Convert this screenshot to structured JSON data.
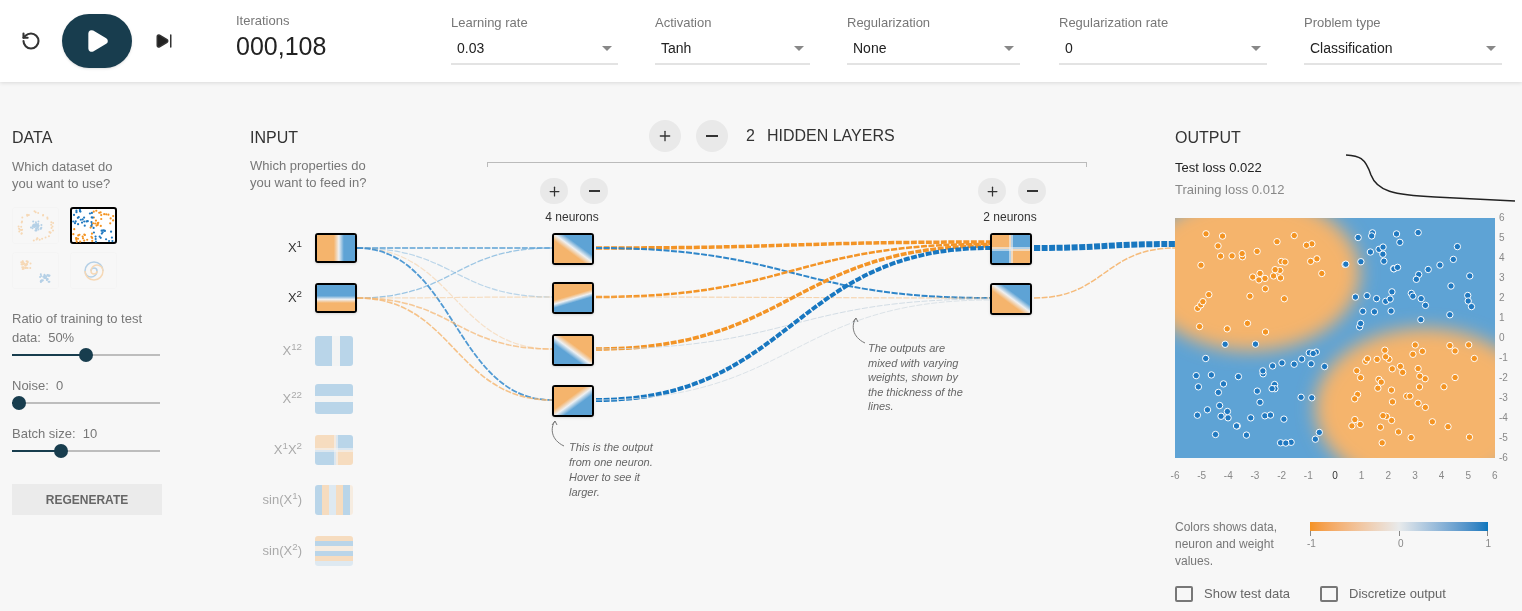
{
  "toolbar": {
    "iterations": {
      "label": "Iterations",
      "value": "000,108"
    },
    "dropdowns": [
      {
        "label": "Learning rate",
        "value": "0.03"
      },
      {
        "label": "Activation",
        "value": "Tanh"
      },
      {
        "label": "Regularization",
        "value": "None"
      },
      {
        "label": "Regularization rate",
        "value": "0"
      },
      {
        "label": "Problem type",
        "value": "Classification"
      }
    ]
  },
  "data": {
    "title": "DATA",
    "question": "Which dataset do you want to use?",
    "datasets": [
      {
        "kind": "circle",
        "selected": false
      },
      {
        "kind": "xor",
        "selected": true
      },
      {
        "kind": "gaussian",
        "selected": false
      },
      {
        "kind": "spiral",
        "selected": false
      }
    ],
    "sliders": [
      {
        "label": "Ratio of training to test data:",
        "value": "50%",
        "level": 0.5
      },
      {
        "label": "Noise:",
        "value": "0",
        "level": 0
      },
      {
        "label": "Batch size:",
        "value": "10",
        "level": 0.31
      }
    ],
    "button": "REGENERATE"
  },
  "input": {
    "title": "INPUT",
    "question": "Which properties do you want to feed in?",
    "features": [
      {
        "label": "X$^{1}$",
        "kind": "x1",
        "selected": true
      },
      {
        "label": "X$^{2}$",
        "kind": "x2",
        "selected": true
      },
      {
        "label": "X$^{12}$",
        "kind": "x1-squared",
        "selected": false
      },
      {
        "label": "X$^{22}$",
        "kind": "x2-squared",
        "selected": false
      },
      {
        "label": "X$^{1}$X$^{2}$",
        "kind": "product",
        "selected": false
      },
      {
        "label": "sin(X$^{1}$)",
        "kind": "sin-x1",
        "selected": false
      },
      {
        "label": "sin(X$^{2}$)",
        "kind": "sin-x2",
        "selected": false
      }
    ]
  },
  "hidden": {
    "count": "2",
    "title": "HIDDEN LAYERS",
    "layers": [
      {
        "label": "4 neurons",
        "neurons": [
          {
            "kind": "grad-bl"
          },
          {
            "kind": "grad-top"
          },
          {
            "kind": "grad-tr"
          },
          {
            "kind": "grad-tl"
          }
        ]
      },
      {
        "label": "2 neurons",
        "neurons": [
          {
            "kind": "quadrants"
          },
          {
            "kind": "grad-bl"
          }
        ]
      }
    ]
  },
  "notes": [
    "This is the output from one neuron. Hover to see it larger.",
    "The outputs are mixed with varying weights, shown by the thickness of the lines."
  ],
  "output": {
    "title": "OUTPUT",
    "test_loss": "Test loss 0.022",
    "training_loss": "Training loss 0.012",
    "x_ticks": [
      "-6",
      "-5",
      "-4",
      "-3",
      "-2",
      "-1",
      "0",
      "1",
      "2",
      "3",
      "4",
      "5",
      "6"
    ],
    "y_ticks": [
      "6",
      "5",
      "4",
      "3",
      "2",
      "1",
      "0",
      "-1",
      "-2",
      "-3",
      "-4",
      "-5",
      "-6"
    ],
    "legend": "Colors shows data, neuron and weight values.",
    "scale_ticks": [
      "-1",
      "0",
      "1"
    ],
    "options": [
      {
        "label": "Show test data",
        "checked": false
      },
      {
        "label": "Discretize output",
        "checked": false
      }
    ]
  }
}
